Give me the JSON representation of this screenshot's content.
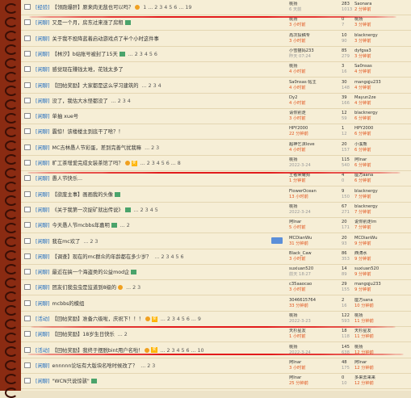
{
  "rows": [
    {
      "tag": "[经验]",
      "title": "【领跑爆肝】原来肉无敌也可以吗？",
      "icon": "hot",
      "pages": "1 ... 2 3 4 5 6 ... 19",
      "author": "桃扬",
      "atime": "6 天前",
      "replies": "283",
      "views": "1013",
      "last": "Saonara",
      "ltime": "2 分钟前"
    },
    {
      "tag": "[闲聊]",
      "title": "又是一个月，房东过来涨了房租",
      "icon": "img",
      "pages": "",
      "author": "桃扬",
      "atime": "3 小时前",
      "replies": "0",
      "views": "7",
      "last": "桃扬",
      "ltime": "3 分钟前"
    },
    {
      "tag": "[闲聊]",
      "title": "关于我不投降蓝着启动游戏点了半个小时这件事",
      "icon": "",
      "pages": "",
      "author": "再次投稿专",
      "atime": "3 小时前",
      "replies": "10",
      "views": "90",
      "last": "blacknergy",
      "ltime": "3 分钟前"
    },
    {
      "tag": "[闲聊]",
      "title": "【林汐】b站账号被封了15天",
      "icon": "img",
      "pages": "... 2 3 4 5 6",
      "author": "小雪猫妈233",
      "atime": "昨天 07:24",
      "replies": "85",
      "views": "279",
      "last": "dyfgsa3",
      "ltime": "3 分钟前"
    },
    {
      "tag": "[闲聊]",
      "title": "感觉现在赚钱太难，花钱太多了",
      "icon": "",
      "pages": "",
      "author": "桃扬",
      "atime": "4 小时前",
      "replies": "3",
      "views": "16",
      "last": "Sa0nsas",
      "ltime": "4 分钟前"
    },
    {
      "tag": "[闲聊]",
      "title": "【回帖奖励】大家都是这么学习建筑的",
      "icon": "",
      "pages": "... 2 3 4",
      "author": "Sa0nsas 帖主",
      "atime": "4 小时前",
      "replies": "30",
      "views": "148",
      "last": "mangqju233",
      "ltime": "4 分钟前"
    },
    {
      "tag": "[闲聊]",
      "title": "没了，我估大水怪都没了",
      "icon": "",
      "pages": "... 2 3 4",
      "author": "Dy2",
      "atime": "4 小时前",
      "replies": "39",
      "views": "166",
      "last": "Mayun2ze",
      "ltime": "4 分钟前"
    },
    {
      "tag": "[闲聊]",
      "title": "单抽 xue号",
      "icon": "",
      "pages": "",
      "author": "请你别走",
      "atime": "3 小时前",
      "replies": "12",
      "views": "59",
      "last": "blacknergy",
      "ltime": "6 分钟前"
    },
    {
      "tag": "[闲聊]",
      "title": "震惊！该楼楼主到底干了啥？！",
      "icon": "",
      "pages": "",
      "author": "HPY2000",
      "atime": "22 分钟前",
      "replies": "1",
      "views": "12",
      "last": "HPY2000",
      "ltime": "6 分钟前"
    },
    {
      "tag": "[闲聊]",
      "title": "MC吉林愚人节彩蛋，差到完善气扰我嘛",
      "icon": "",
      "pages": "... 2 3",
      "author": "超神乞沫love",
      "atime": "4 小时前",
      "replies": "20",
      "views": "157",
      "last": "小溪熊",
      "ltime": "6 分钟前"
    },
    {
      "tag": "[闲聊]",
      "title": "旷工茶增爱完成女装茶馆了吗？",
      "icon": "zd",
      "pages": "... 2 3 4 5 6 ... 8",
      "author": "桃扬",
      "atime": "2022-3-24",
      "replies": "115",
      "views": "540",
      "last": "阿Inar",
      "ltime": "6 分钟前"
    },
    {
      "tag": "[闲聊]",
      "title": "愚人节快乐...",
      "icon": "",
      "pages": "",
      "author": "王者荣耀狗",
      "atime": "1 分钟前",
      "replies": "4",
      "views": "0",
      "last": "座方aana",
      "ltime": "6 分钟前"
    },
    {
      "tag": "[闲聊]",
      "title": "【欲废主事】画画我的头像",
      "icon": "img",
      "pages": "",
      "author": "FlowerOcean",
      "atime": "13 小时前",
      "replies": "9",
      "views": "150",
      "last": "blacknergy",
      "ltime": "7 分钟前"
    },
    {
      "tag": "[闲聊]",
      "title": "《关于我第一次捉矿就出传说》",
      "icon": "img",
      "pages": "... 2 3 4 5",
      "author": "桃扬",
      "atime": "2022-3-24",
      "replies": "67",
      "views": "271",
      "last": "blacknergy",
      "ltime": "7 分钟前"
    },
    {
      "tag": "[闲聊]",
      "title": "今天愚人节mcbbs年嘉明",
      "icon": "img",
      "pages": "... 2",
      "author": "阿Inar",
      "atime": "5 小时前",
      "replies": "20",
      "views": "171",
      "last": "说你别走lm",
      "ltime": "7 分钟前"
    },
    {
      "tag": "[闲聊]",
      "title": "我在mc欢了",
      "icon": "",
      "pages": "... 2 3",
      "author": "MCDianWu",
      "atime": "31 分钟前",
      "replies": "20",
      "views": "93",
      "last": "MCDianWu",
      "ltime": "9 分钟前"
    },
    {
      "tag": "[闲聊]",
      "title": "【调查】现在的mc群众的年龄都在多少岁？",
      "icon": "",
      "pages": "... 2 3 4 5 6",
      "author": "Black_Caw",
      "atime": "3 小时前",
      "replies": "86",
      "views": "353",
      "last": "西涛水",
      "ltime": "9 分钟前"
    },
    {
      "tag": "[闲聊]",
      "title": "最近在搞一个海盗类的公益mod企",
      "icon": "img",
      "pages": "",
      "author": "suxiuan520",
      "atime": "前天 18:27",
      "replies": "14",
      "views": "89",
      "last": "suxiuan520",
      "ltime": "9 分钟前"
    },
    {
      "tag": "[闲聊]",
      "title": "团友们我虫虫是监道到8级的",
      "icon": "hot",
      "pages": "... 2 3",
      "author": "c35aaocao",
      "atime": "3 小时前",
      "replies": "29",
      "views": "155",
      "last": "mangqju233",
      "ltime": "9 分钟前"
    },
    {
      "tag": "[闲聊]",
      "title": "mcbbs的模组",
      "icon": "",
      "pages": "",
      "author": "3046615764",
      "atime": "33 分钟前",
      "replies": "2",
      "views": "16",
      "last": "座方sana",
      "ltime": "10 分钟前"
    },
    {
      "tag": "[活动]",
      "title": "【回帖奖励】准备六级啦，庆祝下！！！",
      "icon": "zd",
      "pages": "... 2 3 4 5 6 ... 9",
      "author": "桃扬",
      "atime": "2022-3-23",
      "replies": "122",
      "views": "593",
      "last": "桃扬",
      "ltime": "11 分钟前"
    },
    {
      "tag": "[闲聊]",
      "title": "【回帖奖励】18岁生日快乐",
      "icon": "",
      "pages": "... 2",
      "author": "天杉星友",
      "atime": "1 小时前",
      "replies": "18",
      "views": "118",
      "last": "天杉星友",
      "ltime": "11 分钟前"
    },
    {
      "tag": "[活动]",
      "title": "【回帖奖励】我终于摆脱bint用户名啦！",
      "icon": "zd",
      "pages": "... 2 3 4 5 6 ... 10",
      "author": "桃扬",
      "atime": "2022-3-24",
      "replies": "145",
      "views": "638",
      "last": "桃扬",
      "ltime": "12 分钟前"
    },
    {
      "tag": "[闲聊]",
      "title": "ennnnn论坛有大版块名啥时候改了？",
      "icon": "",
      "pages": "... 2 3",
      "author": "阿Inar",
      "atime": "3 小时前",
      "replies": "48",
      "views": "175",
      "last": "阿Inar",
      "ltime": "12 分钟前"
    },
    {
      "tag": "[闲聊]",
      "title": "\"WCN只说惊骇\"",
      "icon": "img",
      "pages": "",
      "author": "阿Inar",
      "atime": "25 分钟前",
      "replies": "0",
      "views": "10",
      "last": "多来去来来",
      "ltime": "12 分钟前"
    }
  ]
}
